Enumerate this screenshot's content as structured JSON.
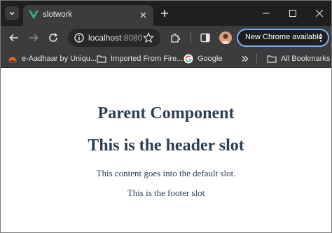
{
  "browser": {
    "tab": {
      "title": "slotwork"
    },
    "address": {
      "host": "localhost",
      "port": ":8080"
    },
    "update_button": {
      "label": "New Chrome available"
    }
  },
  "bookmarks": [
    {
      "label": "e-Aadhaar by Uniqu...",
      "icon": "aadhaar-icon"
    },
    {
      "label": "Imported From Fire...",
      "icon": "folder-icon"
    },
    {
      "label": "Google",
      "icon": "google-icon"
    },
    {
      "label": "All Bookmarks",
      "icon": "folder-icon"
    }
  ],
  "page": {
    "heading": "Parent Component",
    "header_slot": "This is the header slot",
    "default_slot": "This content goes into the default slot.",
    "footer_slot": "This is the footer slot"
  },
  "colors": {
    "title_bar": "#1f1f1f",
    "toolbar": "#3c3c3c",
    "accent_outline": "#7cacf8",
    "page_text": "#2c3e50",
    "vue_green": "#41b883",
    "vue_dark": "#35495e"
  }
}
